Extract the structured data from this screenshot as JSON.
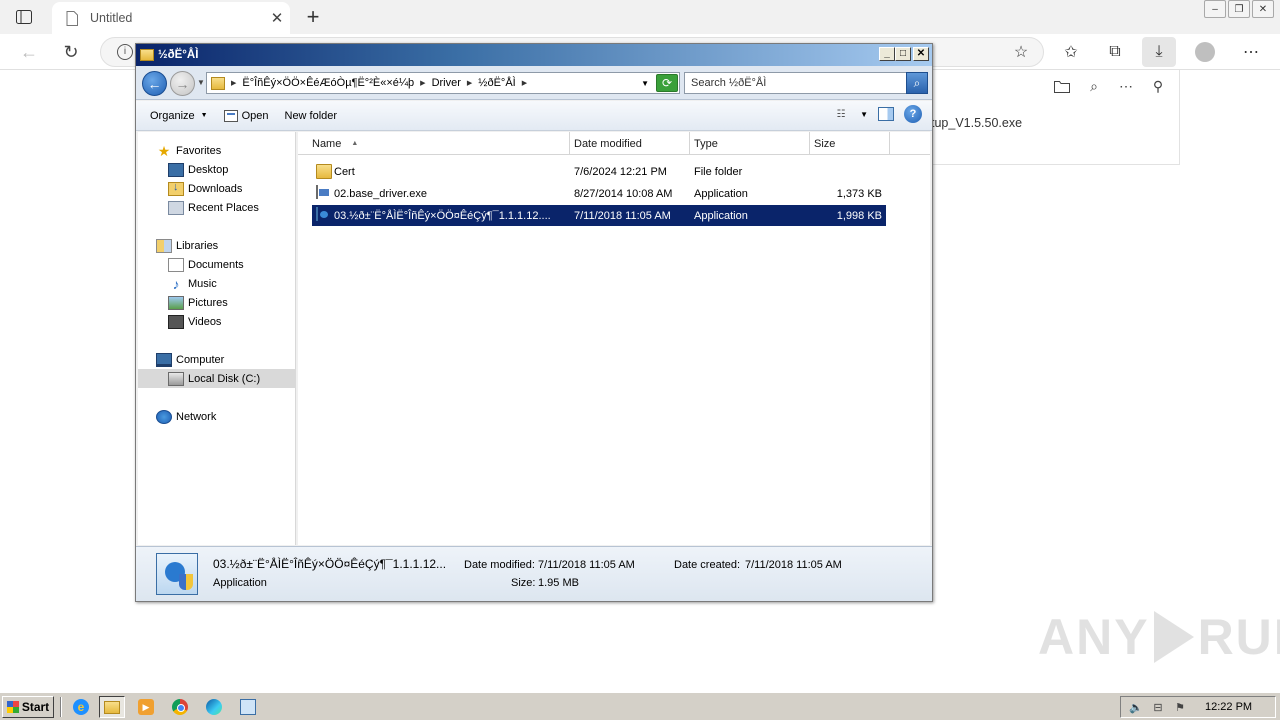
{
  "browser": {
    "tab_title": "Untitled",
    "new_tab_symbol": "+",
    "tab_close_symbol": "✕",
    "download_file": "tup_V1.5.50.exe"
  },
  "explorer": {
    "window_title": "½ðË°ÅÌ",
    "breadcrumbs": [
      "Ë°ÎñÊý×ÖÖ×ÊéÆóÒµ¶Ë°²È«×é¼þ",
      "Driver",
      "½ðË°ÅÌ"
    ],
    "search_placeholder": "Search ½ðË°ÅÌ",
    "command_bar": {
      "organize": "Organize",
      "open": "Open",
      "new_folder": "New folder"
    },
    "nav_pane": {
      "favorites": "Favorites",
      "desktop": "Desktop",
      "downloads": "Downloads",
      "recent_places": "Recent Places",
      "libraries": "Libraries",
      "documents": "Documents",
      "music": "Music",
      "pictures": "Pictures",
      "videos": "Videos",
      "computer": "Computer",
      "local_disk": "Local Disk (C:)",
      "network": "Network"
    },
    "columns": {
      "name": "Name",
      "date": "Date modified",
      "type": "Type",
      "size": "Size"
    },
    "files": [
      {
        "name": "Cert",
        "date": "7/6/2024 12:21 PM",
        "type": "File folder",
        "size": "",
        "icon": "folder-icon"
      },
      {
        "name": "02.base_driver.exe",
        "date": "8/27/2014 10:08 AM",
        "type": "Application",
        "size": "1,373 KB",
        "icon": "exe-icon"
      },
      {
        "name": "03.½ð±¨Ë°ÅÌË°ÎñÊý×ÖÖ¤ÊéÇý¶¯1.1.1.12....",
        "date": "7/11/2018 11:05 AM",
        "type": "Application",
        "size": "1,998 KB",
        "icon": "setup-icon"
      }
    ],
    "details": {
      "name": "03.½ð±¨Ë°ÅÌË°ÎñÊý×ÖÖ¤ÊéÇý¶¯1.1.1.12...",
      "kind": "Application",
      "date_modified_label": "Date modified:",
      "date_modified": "7/11/2018 11:05 AM",
      "date_created_label": "Date created:",
      "date_created": "7/11/2018 11:05 AM",
      "size_label": "Size:",
      "size": "1.95 MB"
    }
  },
  "taskbar": {
    "start_label": "Start",
    "clock": "12:22 PM"
  },
  "watermark": {
    "text_left": "ANY",
    "text_right": "RUN"
  }
}
